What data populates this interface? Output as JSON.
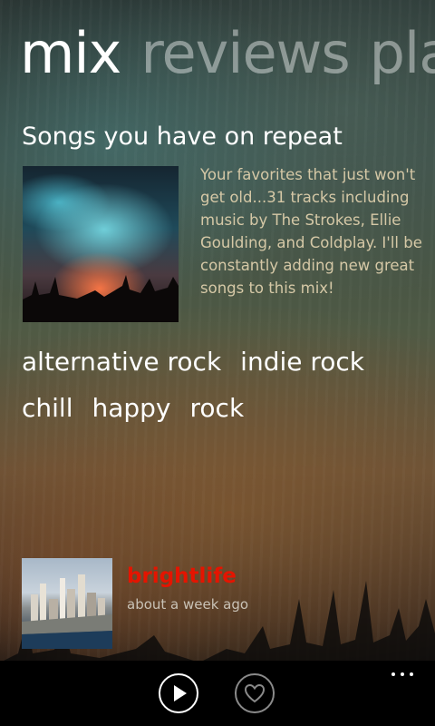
{
  "pivot": {
    "items": [
      {
        "label": "mix",
        "active": true
      },
      {
        "label": "reviews",
        "active": false
      },
      {
        "label": "pla",
        "active": false
      }
    ]
  },
  "mix": {
    "title": "Songs you have on repeat",
    "description": "Your favorites that just won't get old...31 tracks including music by The Strokes, Ellie Goulding, and Coldplay. I'll be constantly adding new great songs to this mix!",
    "tags": [
      [
        "alternative rock",
        "indie rock"
      ],
      [
        "chill",
        "happy",
        "rock"
      ]
    ]
  },
  "activity": {
    "user": "brightlife",
    "time": "about a week ago"
  },
  "appbar": {
    "buttons": [
      {
        "icon": "play-icon"
      },
      {
        "icon": "heart-icon"
      }
    ],
    "more_icon": "ellipsis-icon"
  },
  "colors": {
    "accent": "#e51400",
    "description_text": "#d5c8a6",
    "appbar_bg": "#000000"
  }
}
